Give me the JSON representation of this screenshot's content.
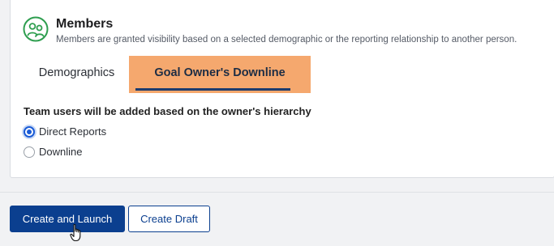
{
  "section": {
    "icon": "people-circle-icon",
    "title": "Members",
    "description": "Members are granted visibility based on a selected demographic or the reporting relationship to another person."
  },
  "tabs": [
    {
      "label": "Demographics",
      "selected": false
    },
    {
      "label": "Goal Owner's Downline",
      "selected": true
    }
  ],
  "hierarchy": {
    "label": "Team users will be added based on the owner's hierarchy",
    "options": [
      {
        "label": "Direct Reports",
        "checked": true
      },
      {
        "label": "Downline",
        "checked": false
      }
    ]
  },
  "footer": {
    "primary_label": "Create and Launch",
    "secondary_label": "Create Draft"
  },
  "colors": {
    "brand": "#0b3f8f",
    "icon_green": "#2e9e4f",
    "active_tab_bg": "#f5a86e",
    "radio_accent": "#1a5bd6"
  }
}
